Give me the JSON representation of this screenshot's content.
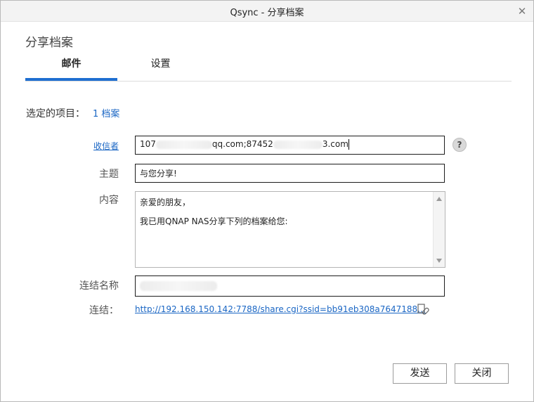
{
  "window": {
    "title": "Qsync - 分享档案"
  },
  "heading": "分享档案",
  "tabs": [
    {
      "label": "邮件",
      "active": true
    },
    {
      "label": "设置",
      "active": false
    }
  ],
  "selected": {
    "label": "选定的项目：",
    "value": "1 档案"
  },
  "form": {
    "recipient_label": "收信者",
    "recipient_value_part1": "107",
    "recipient_value_part2": "qq.com;87452",
    "recipient_value_part3": "3.com",
    "help_label": "?",
    "subject_label": "主题",
    "subject_value": "与您分享!",
    "content_label": "内容",
    "content_line1": "亲爱的朋友，",
    "content_line2": "我已用QNAP NAS分享下列的档案给您:",
    "linkname_label": "连结名称",
    "link_label": "连结：",
    "link_url": "http://192.168.150.142:7788/share.cgi?ssid=bb91eb308a7647188..."
  },
  "buttons": {
    "send": "发送",
    "close": "关闭"
  },
  "colors": {
    "accent": "#1f6fd1",
    "link": "#1a66c4"
  },
  "icons": {
    "close": "close-icon",
    "copy": "copy-link-icon",
    "help": "help-icon"
  }
}
